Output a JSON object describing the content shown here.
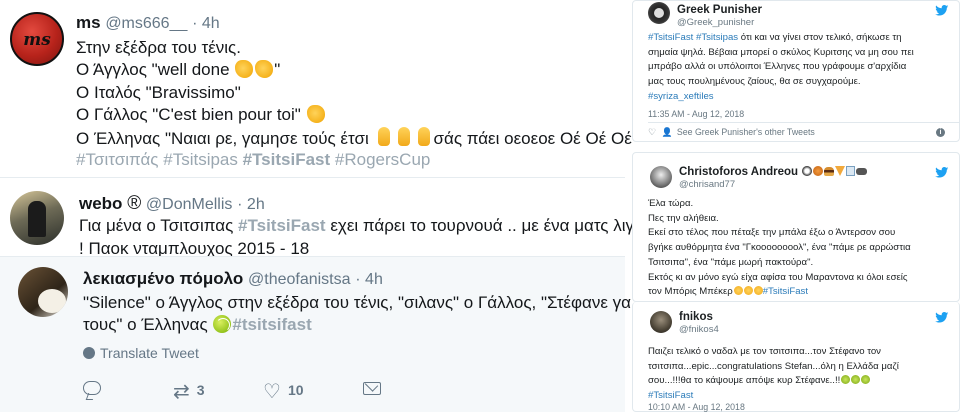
{
  "left_feed": {
    "tweet1": {
      "name": "ms",
      "handle": "@ms666__",
      "time": "· 4h",
      "avatar_text": "ms",
      "lines": [
        "Στην εξέδρα του τένις.",
        "Ο Άγγλος \"well done",
        "\"",
        "Ο Ιταλός \"Bravissimo\"",
        "Ο Γάλλος \"C'est bien pour toi\"",
        "Ο Έλληνας \"Ναιαι ρε, γαμησε τούς έτσι",
        "σάς πάει οεοεοε Οέ Οέ Οέ\""
      ],
      "hashtags": [
        "#Τσιτσιπάς",
        "#Tsitsipas",
        "#TsitsiFast",
        "#RogersCup"
      ]
    },
    "tweet2": {
      "name": "webo",
      "name_symbol": "®",
      "handle": "@DonMellis",
      "time": "· 2h",
      "line1_pre": "Για μένα ο Τσιτσιπας ",
      "line1_tag": "#TsitsiFast",
      "line1_post": " εχει πάρει το τουρνουά .. με ένα ματς λιγότερ",
      "line2": "! Παοκ νταμπλουχος 2015 - 18"
    },
    "tweet3": {
      "name": "λεκιασμένο πόμολο",
      "handle": "@theofanistsa",
      "time": "· 4h",
      "line1": "\"Silence\" ο Άγγλος στην εξέδρα του τένις, \"σιλανς\" ο Γάλλος, \"Στέφανε γαμα",
      "line2_pre": "τους\" ο Έλληνας ",
      "line2_tag": "#tsitsifast",
      "translate_label": "Translate Tweet",
      "retweets": "3",
      "likes": "10"
    }
  },
  "right_feed": {
    "card1": {
      "name": "Greek Punisher",
      "handle": "@Greek_punisher",
      "lines_pre": "",
      "line1_tags": "#TsitsiFast #Tsitsipas",
      "line1_text": " ότι και να γίνει στον τελικό, σήκωσε τη",
      "line2": "σημαία ψηλά. Βέβαια μπορεί ο σκύλος Κυριτσης να μη σου πει",
      "line3": "μπράβο αλλά οι υπόλοιποι Έλληνες που γράφουμε σ'αρχίδια",
      "line4": "μας τους πουλημένους ζαίους, θα σε συγχαρούμε.",
      "line5_tag": "#syriza_xeftiles",
      "date": "11:35 AM - Aug 12, 2018",
      "meta": "See Greek Punisher's other Tweets"
    },
    "card2": {
      "name": "Christoforos Andreou",
      "handle": "@chrisand77",
      "lines": [
        "Έλα τώρα.",
        "Πες την αλήθεια.",
        "Εκεί στο τέλος που πέταξε την μπάλα έξω ο Άντερσον σου",
        "βγήκε αυθόρμητα ένα \"Γκοοοοοοοολ\", ένα \"πάμε ρε αρρώστια",
        "Τσιτσιπα\", ένα \"πάμε μωρή πακτούρα\".",
        "Εκτός κι αν μόνο εγώ είχα αφίσα του Μαραντονα κι όλοι εσείς"
      ],
      "last_line_pre": "τον Μπόρις Μπέκερ",
      "last_line_tag": "#TsitsiFast"
    },
    "card3": {
      "name": "fnikos",
      "handle": "@fnikos4",
      "lines": [
        "Παιζει τελικό ο ναδαλ με τον τσιτσιπα...τον Στέφανο τον",
        "τσιτσιπα...epic...congratulations Stefan...όλη η Ελλάδα μαζί",
        "σου...!!!θα το κάψουμε απόψε κυρ Στέφανε..!!"
      ],
      "tag": "#TsitsiFast",
      "date": "10:10 AM - Aug 12, 2018"
    }
  },
  "colors": {
    "twitter_blue": "#1da1f2",
    "link_blue": "#2b7bb9",
    "muted": "#657786",
    "hashtag_grey": "#9aa7b1"
  }
}
